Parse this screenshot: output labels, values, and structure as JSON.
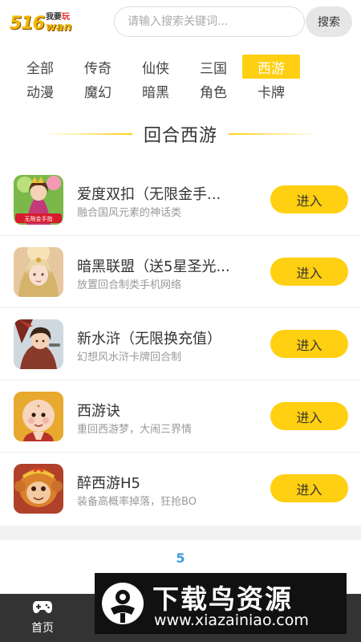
{
  "header": {
    "logo": {
      "number": "516",
      "top_text": "我要",
      "top_highlight": "玩",
      "top_tail": "玩",
      "bottom_text": "wan"
    },
    "search": {
      "placeholder": "请输入搜索关键词...",
      "value": ""
    },
    "search_button_label": "搜索"
  },
  "categories": [
    {
      "label": "全部",
      "active": false
    },
    {
      "label": "传奇",
      "active": false
    },
    {
      "label": "仙侠",
      "active": false
    },
    {
      "label": "三国",
      "active": false
    },
    {
      "label": "西游",
      "active": true
    },
    {
      "label": "动漫",
      "active": false
    },
    {
      "label": "魔幻",
      "active": false
    },
    {
      "label": "暗黑",
      "active": false
    },
    {
      "label": "角色",
      "active": false
    },
    {
      "label": "卡牌",
      "active": false
    }
  ],
  "section_title": "回合西游",
  "games": [
    {
      "name": "爱度双扣（无限金手...",
      "desc": "融合国风元素的神话类",
      "button": "进入",
      "thumb_caption": "无限金手指"
    },
    {
      "name": "暗黑联盟（送5星圣光...",
      "desc": "放置回合制类手机网络",
      "button": "进入"
    },
    {
      "name": "新水浒（无限换充值）",
      "desc": "幻想风水浒卡牌回合制",
      "button": "进入"
    },
    {
      "name": "西游诀",
      "desc": "重回西游梦，大闹三界情",
      "button": "进入"
    },
    {
      "name": "醉西游H5",
      "desc": "装备高概率掉落，狂抢BO",
      "button": "进入"
    }
  ],
  "pagination": {
    "current_page": "5"
  },
  "bottom_nav": {
    "home_label": "首页"
  },
  "watermark": {
    "title": "下载鸟资源",
    "url": "www.xiazainiao.com"
  },
  "colors": {
    "accent": "#ffcf11",
    "page_number": "#3a9be0",
    "nav_bg": "#333333"
  },
  "icons": {
    "home": "gamepad-icon"
  }
}
